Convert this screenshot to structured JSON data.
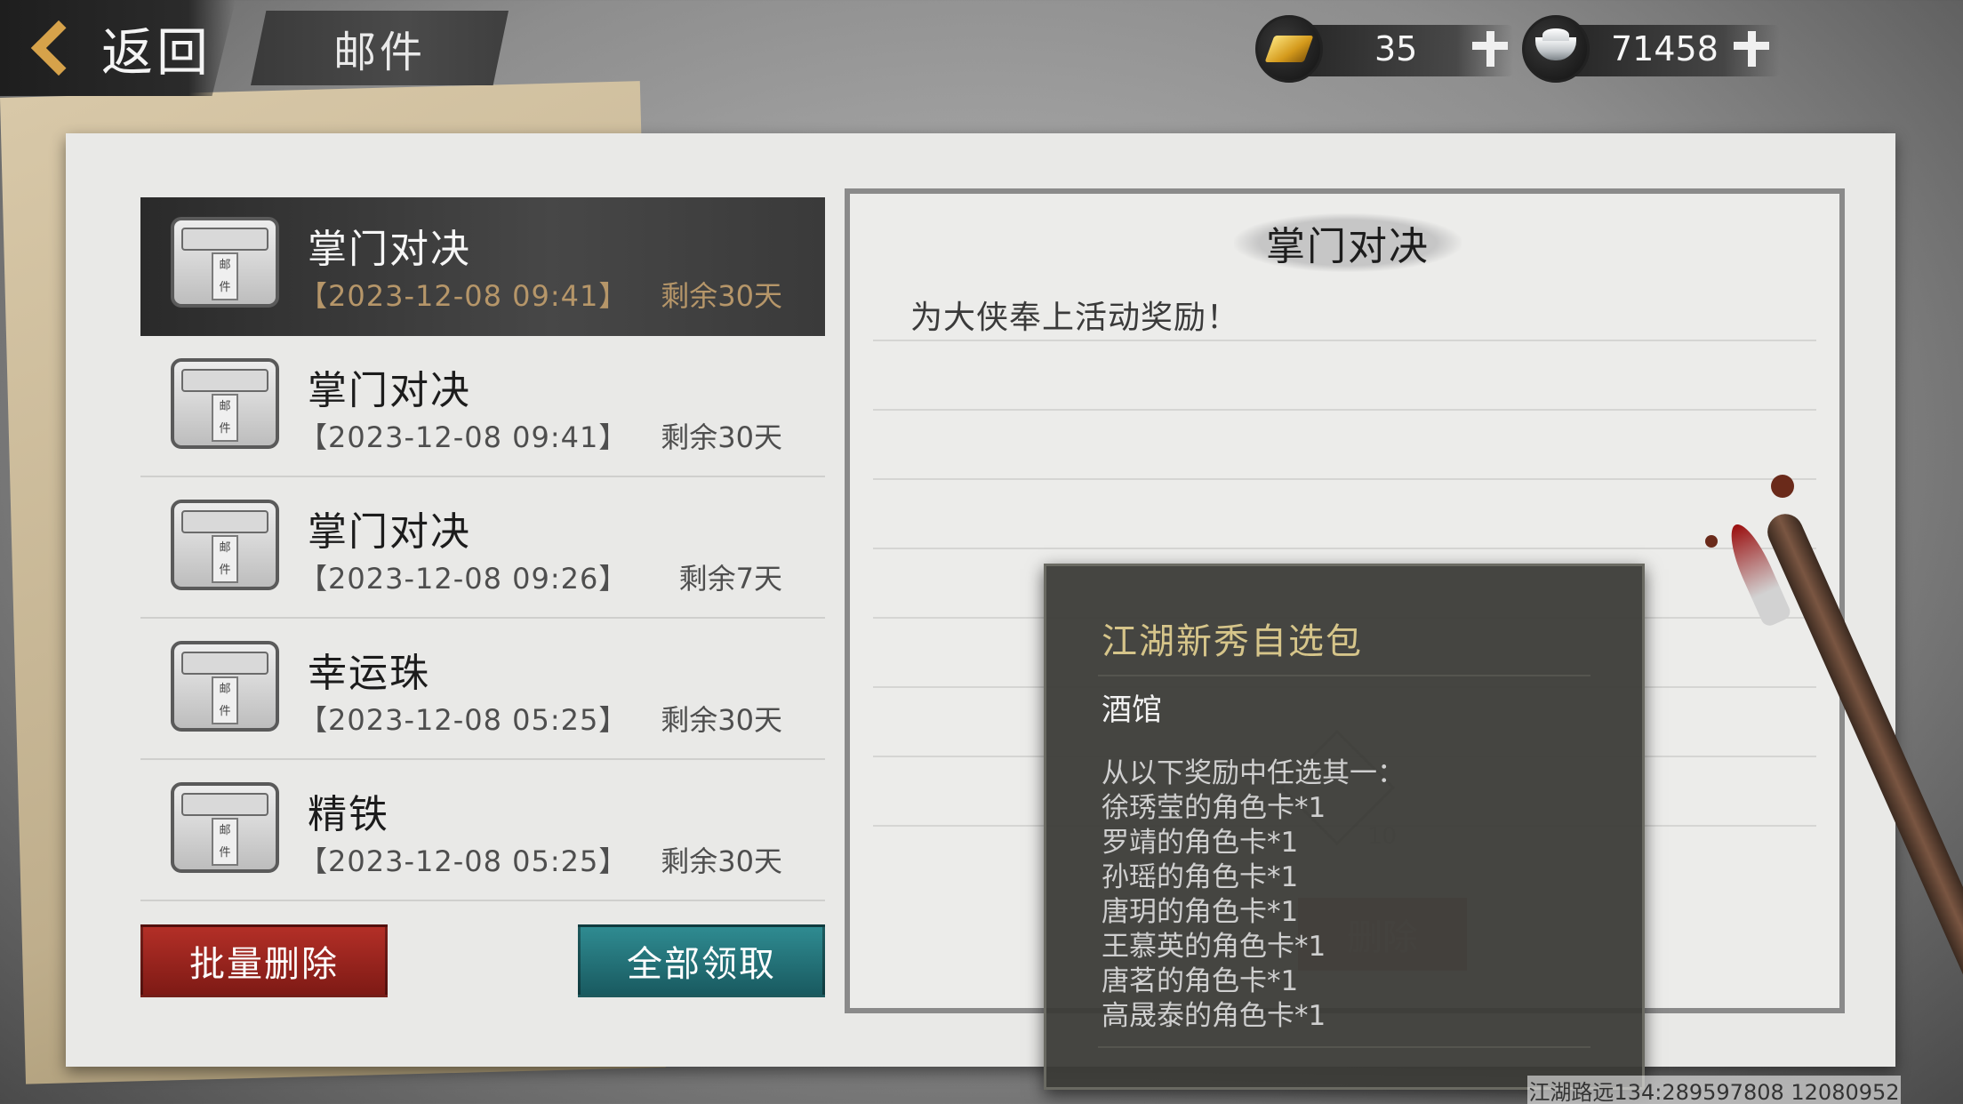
{
  "header": {
    "back_label": "返回",
    "title": "邮件"
  },
  "currencies": [
    {
      "icon": "gold-ingot-icon",
      "value": "35"
    },
    {
      "icon": "silver-ingot-icon",
      "value": "71458"
    }
  ],
  "mail_icon_text": [
    "邮",
    "件"
  ],
  "mails": [
    {
      "title": "掌门对决",
      "date": "【2023-12-08  09:41】",
      "remaining": "剩余30天",
      "selected": true
    },
    {
      "title": "掌门对决",
      "date": "【2023-12-08  09:41】",
      "remaining": "剩余30天",
      "selected": false
    },
    {
      "title": "掌门对决",
      "date": "【2023-12-08  09:26】",
      "remaining": "剩余7天",
      "selected": false
    },
    {
      "title": "幸运珠",
      "date": "【2023-12-08  05:25】",
      "remaining": "剩余30天",
      "selected": false
    },
    {
      "title": "精铁",
      "date": "【2023-12-08  05:25】",
      "remaining": "剩余30天",
      "selected": false
    }
  ],
  "buttons": {
    "batch_delete": "批量删除",
    "claim_all": "全部领取"
  },
  "detail": {
    "title": "掌门对决",
    "body": "为大侠奉上活动奖励！",
    "ghost_count": "10",
    "ghost_delete": "删除"
  },
  "tooltip": {
    "title": "江湖新秀自选包",
    "subtitle": "酒馆",
    "lines": [
      "从以下奖励中任选其一：",
      "徐琇莹的角色卡*1",
      "罗靖的角色卡*1",
      "孙瑶的角色卡*1",
      "唐玥的角色卡*1",
      "王慕英的角色卡*1",
      "唐茗的角色卡*1",
      "高晟泰的角色卡*1"
    ]
  },
  "footer": "江湖路远134:289597808 12080952"
}
